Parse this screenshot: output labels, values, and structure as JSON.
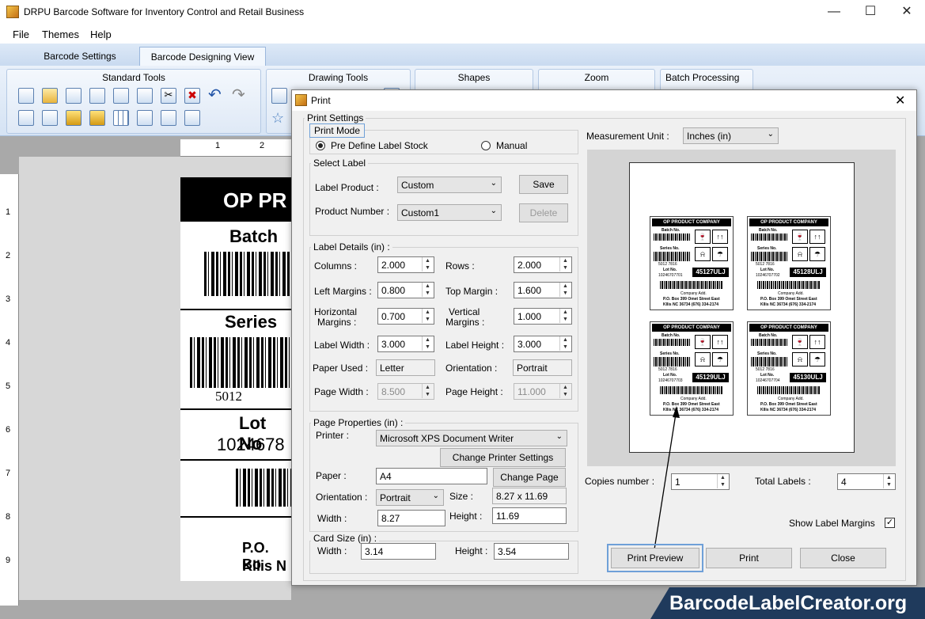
{
  "window": {
    "title": "DRPU Barcode Software for Inventory Control and Retail Business"
  },
  "menu": [
    "File",
    "Themes",
    "Help"
  ],
  "tabs": [
    "Barcode Settings",
    "Barcode Designing View"
  ],
  "ribbon": {
    "groups": [
      "Standard Tools",
      "Drawing Tools",
      "Shapes",
      "Zoom",
      "Batch Processing"
    ]
  },
  "ruler": {
    "top": [
      "1",
      "2"
    ],
    "left": [
      "1",
      "2",
      "3",
      "4",
      "5",
      "6",
      "7",
      "8",
      "9"
    ]
  },
  "label_canvas": {
    "header": "OP PR",
    "batch": "Batch",
    "series": "Series",
    "series_num": "5012",
    "lot": "Lot No",
    "lot_num": "1024678",
    "addr1": "P.O. Bo",
    "addr2": "Kllis N"
  },
  "dialog": {
    "title": "Print",
    "print_settings": "Print Settings",
    "print_mode": "Print Mode",
    "mode_predefine": "Pre Define Label Stock",
    "mode_manual": "Manual",
    "select_label": "Select Label",
    "label_product_lbl": "Label Product :",
    "label_product": "Custom",
    "save": "Save",
    "product_number_lbl": "Product Number :",
    "product_number": "Custom1",
    "delete": "Delete",
    "label_details": "Label Details (in) :",
    "columns_lbl": "Columns :",
    "columns": "2.000",
    "rows_lbl": "Rows :",
    "rows": "2.000",
    "left_margins_lbl": "Left Margins :",
    "left_margins": "0.800",
    "top_margin_lbl": "Top Margin :",
    "top_margin": "1.600",
    "hmargins_lbl1": "Horizontal",
    "hmargins_lbl2": "Margins :",
    "hmargins": "0.700",
    "vmargins_lbl1": "Vertical",
    "vmargins_lbl2": "Margins :",
    "vmargins": "1.000",
    "label_width_lbl": "Label Width :",
    "label_width": "3.000",
    "label_height_lbl": "Label Height :",
    "label_height": "3.000",
    "paper_used_lbl": "Paper Used :",
    "paper_used": "Letter",
    "orientation_lbl": "Orientation :",
    "orientation_ro": "Portrait",
    "page_width_lbl": "Page Width :",
    "page_width": "8.500",
    "page_height_lbl": "Page Height :",
    "page_height": "11.000",
    "page_properties": "Page Properties (in) :",
    "printer_lbl": "Printer :",
    "printer": "Microsoft XPS Document Writer",
    "change_printer": "Change Printer Settings",
    "paper_lbl": "Paper :",
    "paper": "A4",
    "change_page": "Change Page",
    "orient2_lbl": "Orientation :",
    "orient2": "Portrait",
    "size_lbl": "Size :",
    "size": "8.27 x 11.69",
    "width_lbl": "Width :",
    "width": "8.27",
    "height_lbl": "Height :",
    "height": "11.69",
    "card_size": "Card Size (in) :",
    "card_width_lbl": "Width :",
    "card_width": "3.14",
    "card_height_lbl": "Height :",
    "card_height": "3.54",
    "measurement_lbl": "Measurement Unit :",
    "measurement": "Inches (in)",
    "copies_lbl": "Copies number :",
    "copies": "1",
    "total_lbl": "Total Labels :",
    "total": "4",
    "show_margins": "Show Label Margins",
    "print_preview": "Print Preview",
    "print": "Print",
    "close": "Close"
  },
  "preview_labels": [
    {
      "company": "OP PRODUCT COMPANY",
      "batch": "Batch No.",
      "series": "Series No.",
      "lot": "Lot No.",
      "code": "45127ULJ",
      "lotnum": "10246707701",
      "seriesnum": "5012      7816",
      "addr_title": "Company Add.",
      "addr1": "P.O. Box 399 Omet Street East",
      "addr2": "Kllis NC 36734 (676) 334-2174"
    },
    {
      "company": "OP PRODUCT COMPANY",
      "batch": "Batch No.",
      "series": "Series No.",
      "lot": "Lot No.",
      "code": "45128ULJ",
      "lotnum": "10246707702",
      "seriesnum": "5012      7816",
      "addr_title": "Company Add.",
      "addr1": "P.O. Box 399 Omet Street East",
      "addr2": "Kllis NC 36734 (676) 334-2174"
    },
    {
      "company": "OP PRODUCT COMPANY",
      "batch": "Batch No.",
      "series": "Series No.",
      "lot": "Lot No.",
      "code": "45129ULJ",
      "lotnum": "10246707703",
      "seriesnum": "5012      7816",
      "addr_title": "Company Add.",
      "addr1": "P.O. Box 399 Omet Street East",
      "addr2": "Kllis NC 36734 (676) 334-2174"
    },
    {
      "company": "OP PRODUCT COMPANY",
      "batch": "Batch No.",
      "series": "Series No.",
      "lot": "Lot No.",
      "code": "45130ULJ",
      "lotnum": "10246707704",
      "seriesnum": "5012      7816",
      "addr_title": "Company Add.",
      "addr1": "P.O. Box 399 Omet Street East",
      "addr2": "Kllis NC 36734 (676) 334-2174"
    }
  ],
  "watermark": "BarcodeLabelCreator.org"
}
